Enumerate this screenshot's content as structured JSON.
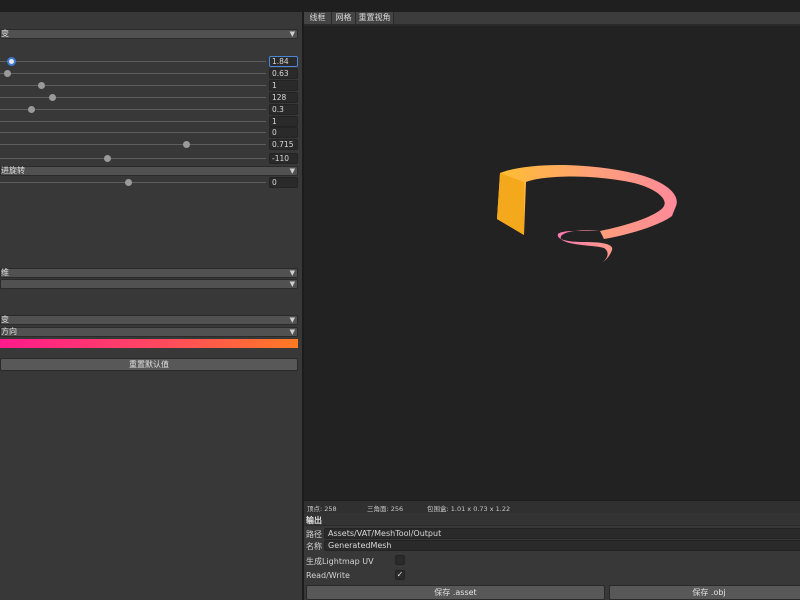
{
  "inspector": {
    "dropdown_top": {
      "value": "变"
    },
    "sliders": [
      {
        "value": "1.84",
        "level": 0.04,
        "active": true
      },
      {
        "value": "0.63",
        "level": 0.026
      },
      {
        "value": "1",
        "level": 0.155
      },
      {
        "value": "128",
        "level": 0.197
      },
      {
        "value": "0.3",
        "level": 0.117
      },
      {
        "value": "1"
      },
      {
        "value": "0"
      },
      {
        "value": "0.715",
        "level": 0.699
      },
      {
        "value": "-110",
        "level": 0.402
      }
    ],
    "dropdown_rotation": {
      "value": "进旋转"
    },
    "slider_after_rotation": {
      "value": "0",
      "level": 0.481
    },
    "dropdown_3": {
      "value": "维"
    },
    "dropdown_4": {
      "value": ""
    },
    "dropdown_5": {
      "value": "变"
    },
    "dropdown_6": {
      "value": "方向"
    },
    "gradient_colors": [
      "#ff1a8c",
      "#ff4a5e",
      "#ff7a22"
    ],
    "reset_label": "重置默认值"
  },
  "viewport": {
    "buttons": {
      "wireframe": "线框",
      "grid": "网格",
      "reset_view": "重置视角"
    },
    "mesh_colors": {
      "outer": "#ffbf2e",
      "mid": "#ff9f7a",
      "inner": "#ff7aa8"
    }
  },
  "stats": {
    "vertices": "顶点: 258",
    "triangles": "三角面: 256",
    "bounds": "包围盒: 1.01 x 0.73 x 1.22"
  },
  "output": {
    "title": "输出",
    "path_label": "路径",
    "path_value": "Assets/VAT/MeshTool/Output",
    "name_label": "名称",
    "name_value": "GeneratedMesh",
    "lightmap_label": "生成Lightmap UV",
    "lightmap_checked": false,
    "readwrite_label": "Read/Write",
    "readwrite_checked": true,
    "readwrite_mark": "✓",
    "save_asset_label": "保存 .asset",
    "save_obj_label": "保存 .obj"
  }
}
